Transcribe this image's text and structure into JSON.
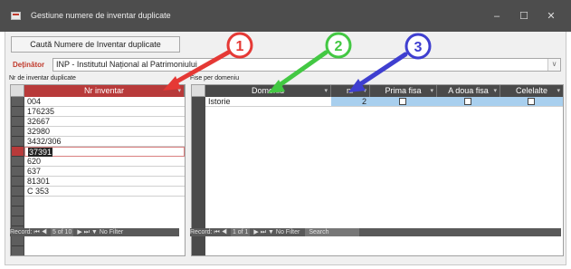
{
  "window": {
    "title": "Gestiune numere de inventar duplicate",
    "minimize": "–",
    "maximize": "☐",
    "close": "✕"
  },
  "toolbar": {
    "search_button": "Caută Numere de Inventar duplicate"
  },
  "owner": {
    "label": "Deținător",
    "value": "INP - Institutul Național al Patrimoniului"
  },
  "left_panel": {
    "label": "Nr de inventar duplicate",
    "header": "Nr inventar",
    "rows": [
      "004",
      "176235",
      "32667",
      "32980",
      "3432/306",
      "37391",
      "620",
      "637",
      "81301",
      "C 353"
    ],
    "selected_index": 5,
    "nav": {
      "record_label": "Record:",
      "position": "5 of 10",
      "filter": "No Filter"
    }
  },
  "right_panel": {
    "label": "Fise per domeniu",
    "headers": [
      "Domeniu",
      "nr",
      "Prima fisa",
      "A doua fisa",
      "Celelalte"
    ],
    "rows": [
      {
        "domeniu": "Istorie",
        "nr": "2",
        "prima": false,
        "adoua": false,
        "celelalte": false
      }
    ],
    "nav": {
      "record_label": "Record:",
      "position": "1 of 1",
      "filter": "No Filter",
      "search": "Search"
    }
  },
  "annotations": {
    "labels": [
      "1",
      "2",
      "3"
    ],
    "colors": {
      "one": "#e53935",
      "two": "#43c843",
      "three": "#3f3fd0"
    }
  }
}
